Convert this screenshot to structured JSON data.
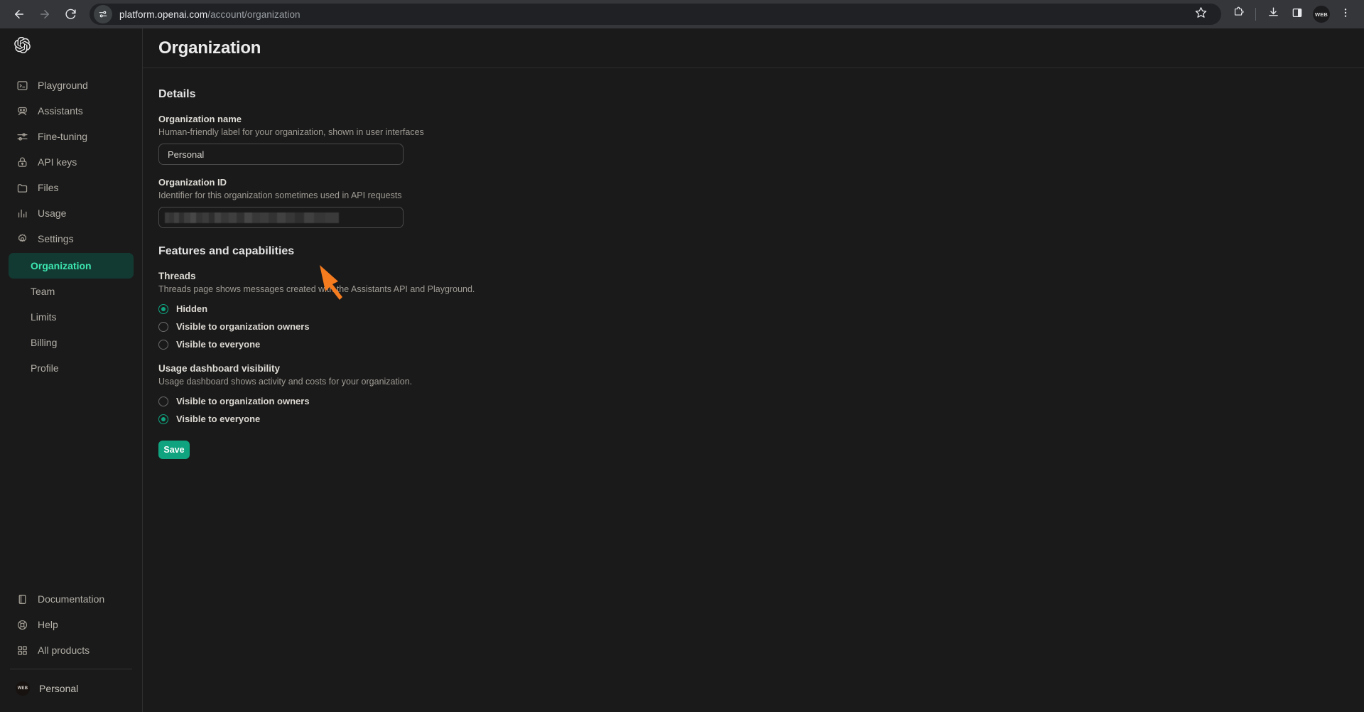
{
  "browser": {
    "back_icon": "back-arrow-icon",
    "forward_icon": "forward-arrow-icon",
    "reload_icon": "reload-icon",
    "site_settings_icon": "site-settings-icon",
    "url_domain": "platform.openai.com",
    "url_path": "/account/organization",
    "bookmark_icon": "star-icon",
    "extensions_icon": "extensions-puzzle-icon",
    "downloads_icon": "download-icon",
    "side_panel_icon": "side-panel-icon",
    "profile_initials": "WEB",
    "menu_icon": "three-dot-menu-icon"
  },
  "sidebar": {
    "brand_icon": "openai-logo-icon",
    "items": [
      {
        "label": "Playground",
        "icon": "terminal-icon"
      },
      {
        "label": "Assistants",
        "icon": "robot-icon"
      },
      {
        "label": "Fine-tuning",
        "icon": "sliders-icon"
      },
      {
        "label": "API keys",
        "icon": "lock-icon"
      },
      {
        "label": "Files",
        "icon": "folder-icon"
      },
      {
        "label": "Usage",
        "icon": "bar-chart-icon"
      },
      {
        "label": "Settings",
        "icon": "gear-icon"
      }
    ],
    "sub_items": [
      {
        "label": "Organization",
        "active": true
      },
      {
        "label": "Team",
        "active": false
      },
      {
        "label": "Limits",
        "active": false
      },
      {
        "label": "Billing",
        "active": false
      },
      {
        "label": "Profile",
        "active": false
      }
    ],
    "bottom_items": [
      {
        "label": "Documentation",
        "icon": "book-icon"
      },
      {
        "label": "Help",
        "icon": "life-ring-icon"
      },
      {
        "label": "All products",
        "icon": "grid-icon"
      }
    ],
    "account": {
      "label": "Personal",
      "avatar_initials": "WEB"
    }
  },
  "header": {
    "title": "Organization"
  },
  "details": {
    "section_title": "Details",
    "org_name": {
      "label": "Organization name",
      "description": "Human-friendly label for your organization, shown in user interfaces",
      "value": "Personal"
    },
    "org_id": {
      "label": "Organization ID",
      "description": "Identifier for this organization sometimes used in API requests",
      "value": "",
      "redacted": true
    }
  },
  "features": {
    "section_title": "Features and capabilities",
    "threads": {
      "label": "Threads",
      "description": "Threads page shows messages created with the Assistants API and Playground.",
      "options": [
        {
          "label": "Hidden",
          "selected": true
        },
        {
          "label": "Visible to organization owners",
          "selected": false
        },
        {
          "label": "Visible to everyone",
          "selected": false
        }
      ]
    },
    "usage_dashboard": {
      "label": "Usage dashboard visibility",
      "description": "Usage dashboard shows activity and costs for your organization.",
      "options": [
        {
          "label": "Visible to organization owners",
          "selected": false
        },
        {
          "label": "Visible to everyone",
          "selected": true
        }
      ]
    },
    "save_label": "Save"
  },
  "annotation": {
    "arrow_icon": "orange-arrow-pointer",
    "color": "#F57B1F"
  },
  "colors": {
    "accent_green": "#10a37f",
    "active_nav_text": "#3ce6b0",
    "active_nav_bg": "#133a32",
    "page_bg": "#1a1a1a",
    "chrome_bg": "#35363a"
  }
}
